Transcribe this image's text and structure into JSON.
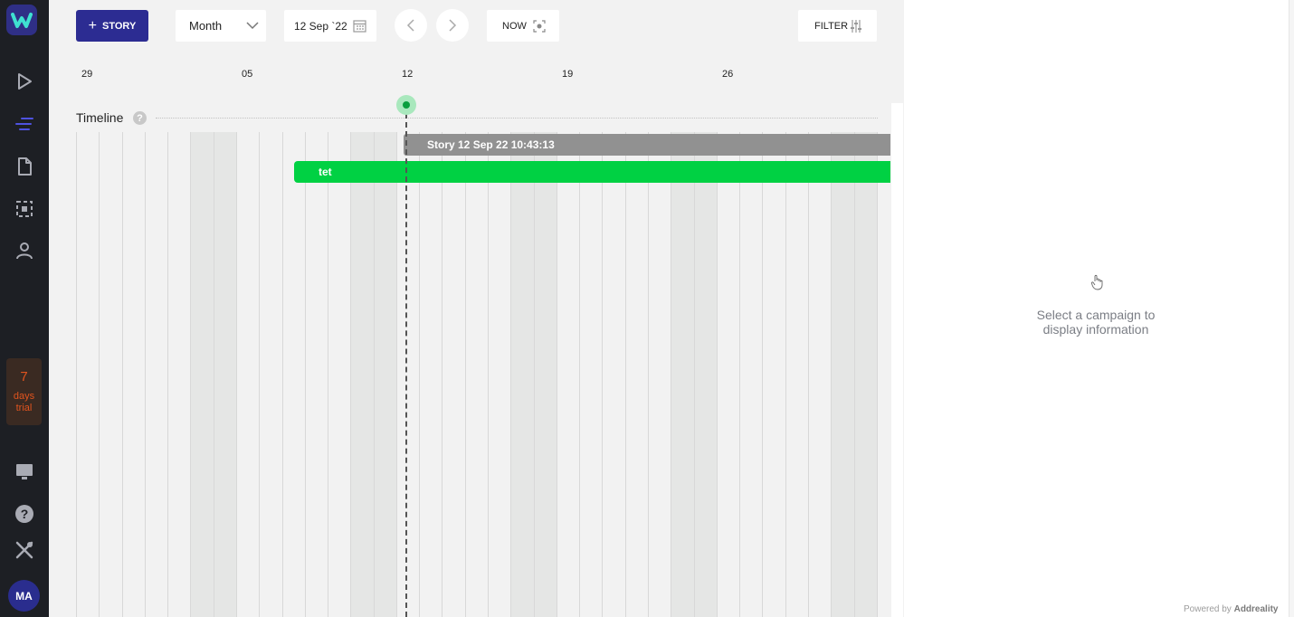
{
  "sidebar": {
    "logo": "app-logo",
    "trial_number": "7",
    "trial_text_1": "days",
    "trial_text_2": "trial",
    "avatar_initials": "MA",
    "accent_color": "#2f2f86",
    "trial_color": "#e0541e"
  },
  "toolbar": {
    "story_label": "STORY",
    "view_select": "Month",
    "date_value": "12 Sep `22",
    "now_label": "NOW",
    "filter_label": "FILTER"
  },
  "timeline": {
    "dates": [
      "29",
      "05",
      "12",
      "19",
      "26"
    ],
    "title": "Timeline",
    "help_glyph": "?",
    "bars": [
      {
        "label": "Story 12 Sep 22 10:43:13",
        "color": "#919191"
      },
      {
        "label": "tet",
        "color": "#00d143"
      }
    ]
  },
  "panel": {
    "message_line1": "Select a campaign to",
    "message_line2": "display information",
    "powered_by": "Powered by",
    "brand": "Addreality"
  }
}
